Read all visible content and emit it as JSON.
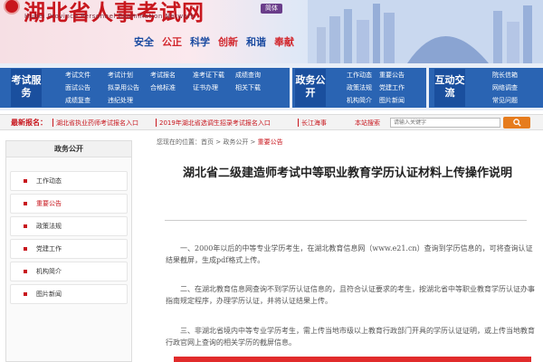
{
  "header": {
    "site_title": "湖北省人事考试网",
    "site_subtitle": "Hubei Province Personnel Examination Network",
    "lang_button": "简体",
    "slogan": [
      "安全",
      "公正",
      "科学",
      "创新",
      "和谐",
      "奉献"
    ]
  },
  "nav": {
    "exam_service": {
      "heading": "考试服务",
      "links": [
        "考试文件",
        "考试计划",
        "考试报名",
        "准考证下载",
        "成绩查询",
        "面试公告",
        "拟录用公告",
        "合格标准",
        "证书办理",
        "相关下载",
        "成绩复查",
        "违纪处理"
      ]
    },
    "gov_affairs": {
      "heading": "政务公开",
      "links": [
        "工作动态",
        "重要公告",
        "政策法规",
        "党建工作",
        "机构简介",
        "图片新闻"
      ]
    },
    "interaction": {
      "heading": "互动交流",
      "links": [
        "院长信箱",
        "网络调查",
        "常见问题"
      ]
    }
  },
  "ticker": {
    "label": "最新报名：",
    "items": [
      "湖北省执业药师考试报名入口",
      "2019年湖北省选调生招录考试报名入口",
      "长江海事"
    ],
    "search_label": "本站搜索",
    "search_placeholder": "请输入关键字"
  },
  "sidebar": {
    "heading": "政务公开",
    "items": [
      {
        "label": "工作动态",
        "active": false
      },
      {
        "label": "重要公告",
        "active": true
      },
      {
        "label": "政策法规",
        "active": false
      },
      {
        "label": "党建工作",
        "active": false
      },
      {
        "label": "机构简介",
        "active": false
      },
      {
        "label": "图片新闻",
        "active": false
      }
    ]
  },
  "breadcrumb": {
    "prefix": "您现在的位置：",
    "home": "首页",
    "sep1": " > ",
    "section": "政务公开",
    "sep2": " > ",
    "current": "重要公告"
  },
  "article": {
    "title": "湖北省二级建造师考试中等职业教育学历认证材料上传操作说明",
    "paragraphs": [
      "一、2000年以后的中等专业学历考生，在湖北教育信息网（www.e21.cn）查询到学历信息的，可将查询认证结果截屏，生成pdf格式上传。",
      "二、在湖北教育信息网查询不到学历认证信息的，且符合认证要求的考生，按湖北省中等职业教育学历认证办事指南规定程序，办理学历认证，并将认证结果上传。",
      "三、非湖北省境内中等专业学历考生，需上传当地市级以上教育行政部门开具的学历认证证明，或上传当地教育行政官网上查询的相关学历的截屏信息。"
    ]
  },
  "colors": {
    "brand_red": "#c8161d",
    "nav_blue": "#2a64b3",
    "search_orange": "#e67c1e"
  }
}
